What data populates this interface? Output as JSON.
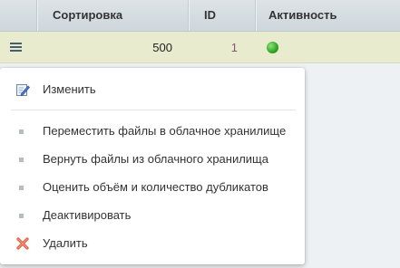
{
  "table": {
    "headers": {
      "sort": "Сортировка",
      "id": "ID",
      "active": "Активность"
    },
    "row": {
      "sort": "500",
      "id": "1",
      "active_status": "active",
      "active_color": "#2fa520"
    }
  },
  "menu": {
    "edit": "Изменить",
    "move": "Переместить файлы в облачное хранилище",
    "restore": "Вернуть файлы из облачного хранилища",
    "estimate": "Оценить объём и количество дубликатов",
    "deactivate": "Деактивировать",
    "delete": "Удалить"
  },
  "icons": {
    "row_menu": "hamburger-icon",
    "edit": "edit-pencil-icon",
    "delete": "delete-cross-icon"
  }
}
